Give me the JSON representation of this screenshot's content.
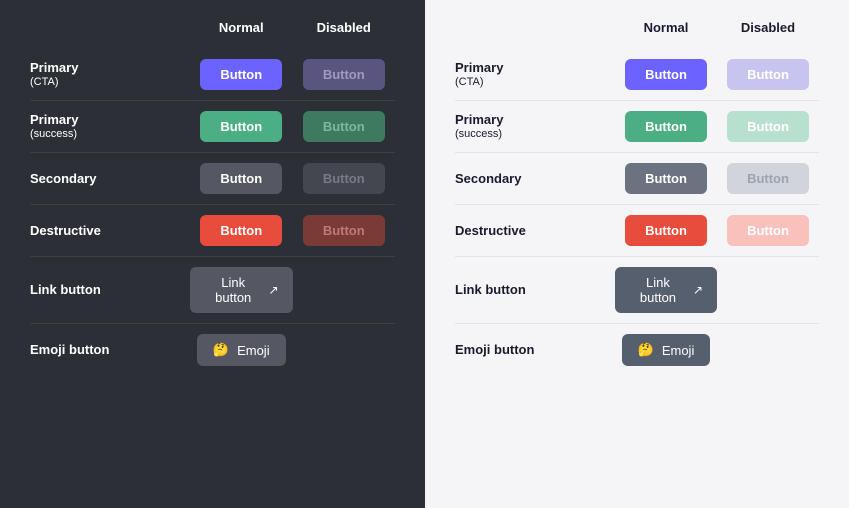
{
  "dark": {
    "header": {
      "normal": "Normal",
      "disabled": "Disabled"
    },
    "rows": [
      {
        "label": "Primary",
        "sublabel": "(CTA)",
        "normal_class": "btn-primary-cta",
        "disabled_class": "btn-primary-cta-disabled-dark",
        "normal_text": "Button",
        "disabled_text": "Button"
      },
      {
        "label": "Primary",
        "sublabel": "(success)",
        "normal_class": "btn-primary-success",
        "disabled_class": "btn-primary-success-disabled-dark",
        "normal_text": "Button",
        "disabled_text": "Button"
      },
      {
        "label": "Secondary",
        "sublabel": "",
        "normal_class": "btn-secondary-dark",
        "disabled_class": "btn-secondary-disabled-dark",
        "normal_text": "Button",
        "disabled_text": "Button"
      },
      {
        "label": "Destructive",
        "sublabel": "",
        "normal_class": "btn-destructive",
        "disabled_class": "btn-destructive-disabled-dark",
        "normal_text": "Button",
        "disabled_text": "Button"
      }
    ],
    "link_label": "Link button",
    "link_text": "Link button",
    "emoji_label": "Emoji button",
    "emoji_text": "Emoji"
  },
  "light": {
    "header": {
      "normal": "Normal",
      "disabled": "Disabled"
    },
    "rows": [
      {
        "label": "Primary",
        "sublabel": "(CTA)",
        "normal_class": "btn-primary-cta",
        "disabled_class": "btn-primary-cta-disabled-light",
        "normal_text": "Button",
        "disabled_text": "Button"
      },
      {
        "label": "Primary",
        "sublabel": "(success)",
        "normal_class": "btn-primary-success",
        "disabled_class": "btn-primary-success-disabled-light",
        "normal_text": "Button",
        "disabled_text": "Button"
      },
      {
        "label": "Secondary",
        "sublabel": "",
        "normal_class": "btn-secondary-light",
        "disabled_class": "btn-secondary-disabled-light",
        "normal_text": "Button",
        "disabled_text": "Button"
      },
      {
        "label": "Destructive",
        "sublabel": "",
        "normal_class": "btn-destructive",
        "disabled_class": "btn-destructive-disabled-light",
        "normal_text": "Button",
        "disabled_text": "Button"
      }
    ],
    "link_label": "Link button",
    "link_text": "Link button",
    "emoji_label": "Emoji button",
    "emoji_text": "Emoji"
  }
}
